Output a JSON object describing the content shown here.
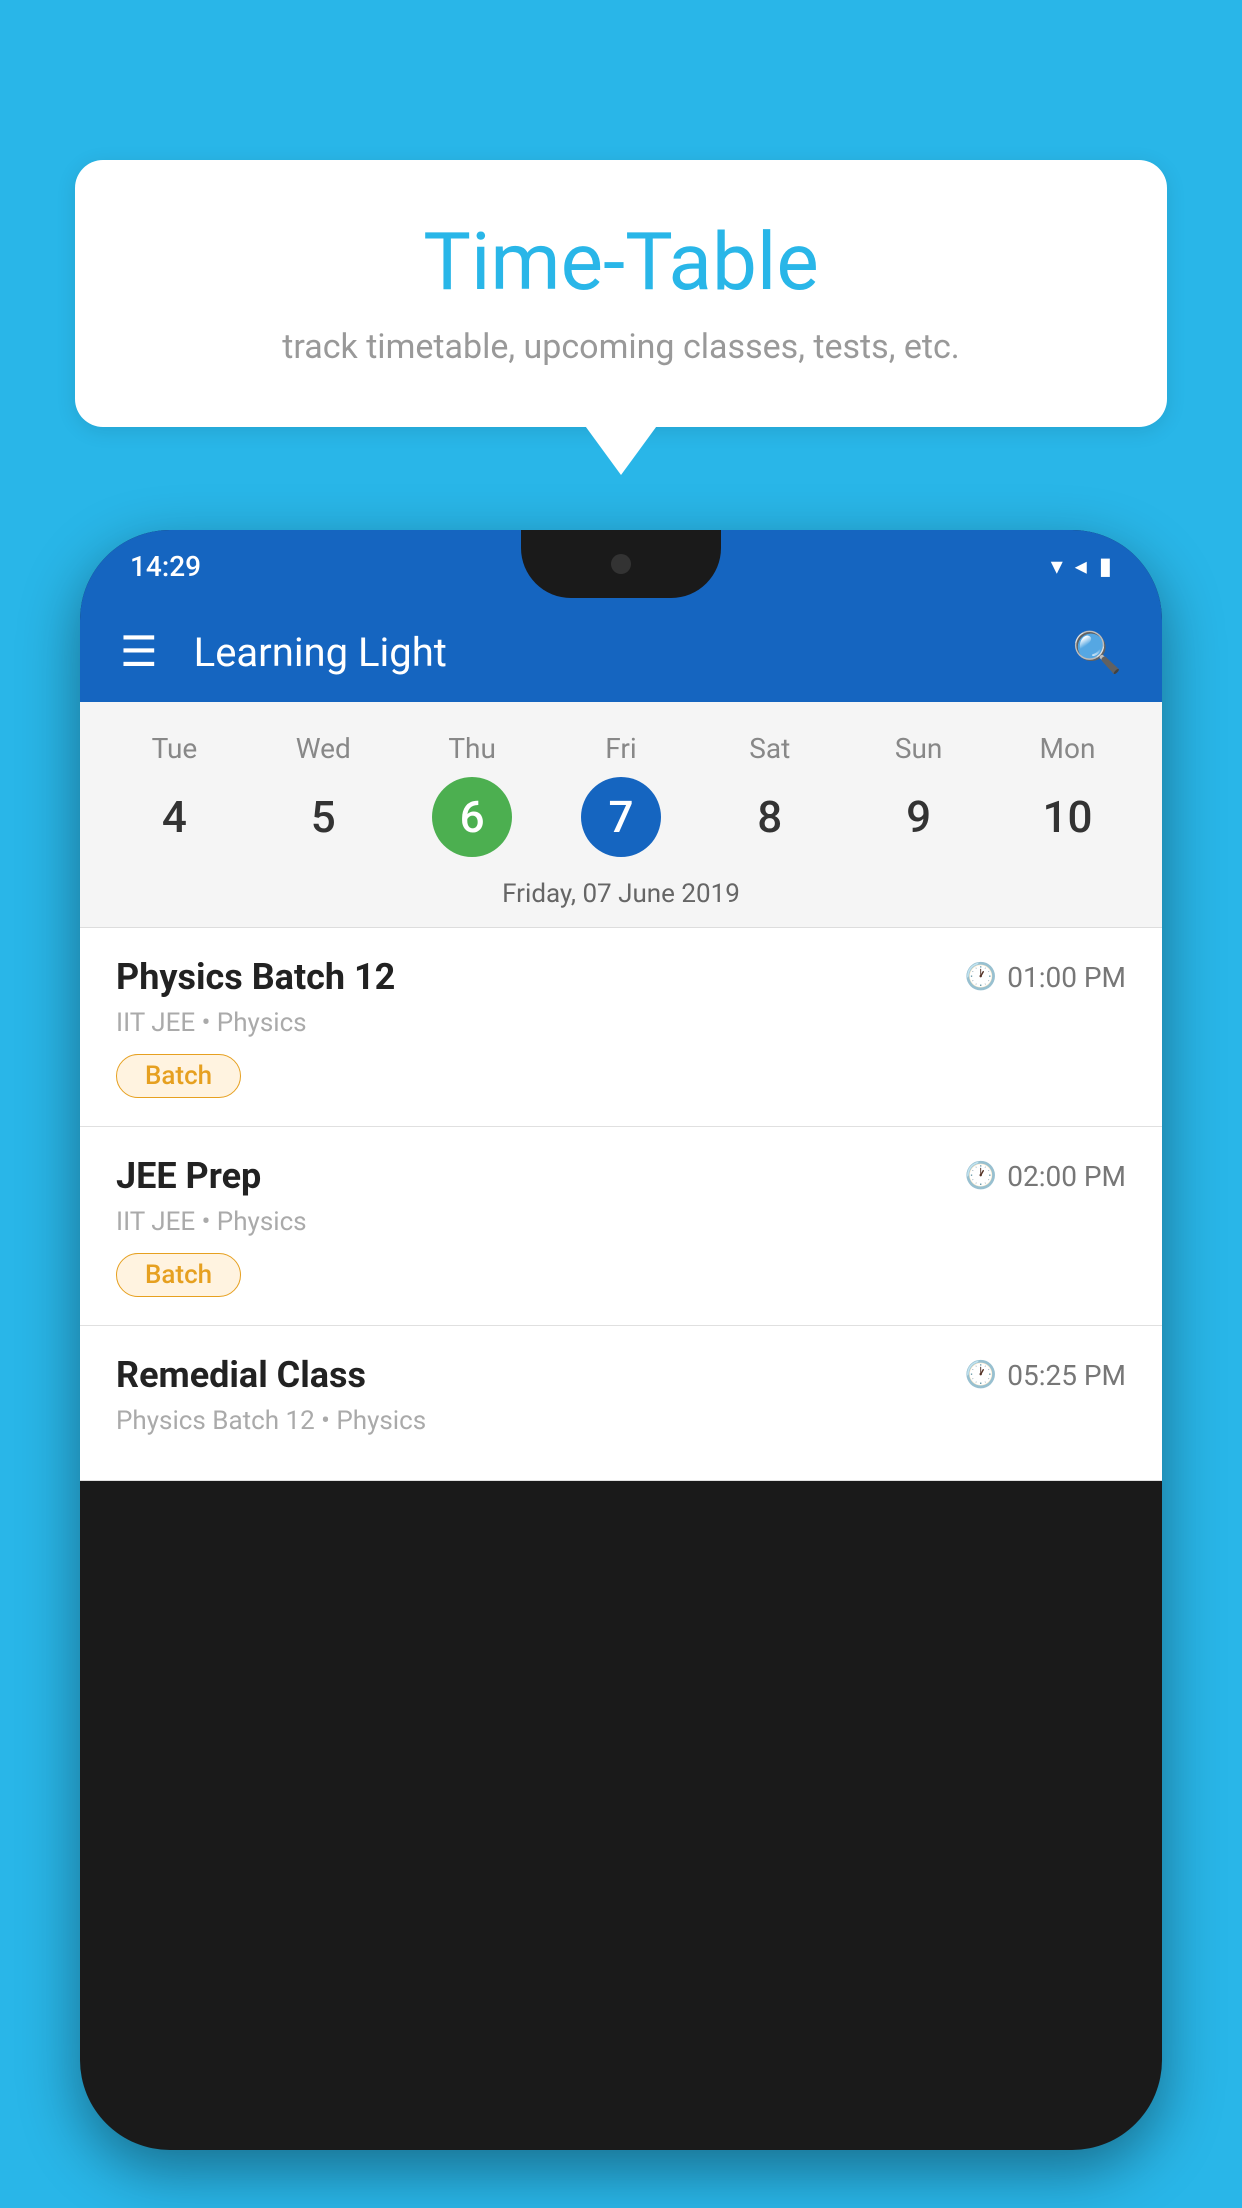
{
  "background_color": "#29B6E8",
  "speech_bubble": {
    "title": "Time-Table",
    "subtitle": "track timetable, upcoming classes, tests, etc."
  },
  "phone": {
    "status_bar": {
      "time": "14:29",
      "signal_icons": "▾◂▮"
    },
    "app_bar": {
      "title": "Learning Light",
      "menu_icon": "☰",
      "search_icon": "🔍"
    },
    "calendar": {
      "days": [
        {
          "name": "Tue",
          "num": "4",
          "state": "normal"
        },
        {
          "name": "Wed",
          "num": "5",
          "state": "normal"
        },
        {
          "name": "Thu",
          "num": "6",
          "state": "today"
        },
        {
          "name": "Fri",
          "num": "7",
          "state": "selected"
        },
        {
          "name": "Sat",
          "num": "8",
          "state": "normal"
        },
        {
          "name": "Sun",
          "num": "9",
          "state": "normal"
        },
        {
          "name": "Mon",
          "num": "10",
          "state": "normal"
        }
      ],
      "selected_date_label": "Friday, 07 June 2019"
    },
    "schedule_items": [
      {
        "name": "Physics Batch 12",
        "time": "01:00 PM",
        "meta": "IIT JEE • Physics",
        "badge": "Batch"
      },
      {
        "name": "JEE Prep",
        "time": "02:00 PM",
        "meta": "IIT JEE • Physics",
        "badge": "Batch"
      },
      {
        "name": "Remedial Class",
        "time": "05:25 PM",
        "meta": "Physics Batch 12 • Physics",
        "badge": null
      }
    ]
  }
}
